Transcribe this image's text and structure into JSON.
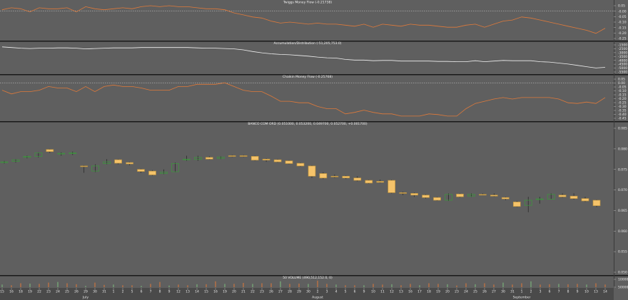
{
  "colors": {
    "background": "#5f5f5f",
    "separator": "#1a1a1a",
    "axis_strip": "#4a4a4a",
    "dotted_ref": "#d8d8d8",
    "orange": "#e07a3a",
    "white_line": "#f0f0f0",
    "candle_up": "#3a9a3a",
    "candle_down": "#f5c36a",
    "wick": "#222222"
  },
  "panels": [
    {
      "id": "twiggs",
      "title": "Twiggs Money Flow (-0.21738)",
      "yticks": [
        "0.05",
        "-0.00",
        "-0.05",
        "-0.10",
        "-0.15",
        "-0.20",
        "-0.25"
      ],
      "ylim": [
        -0.27,
        0.05
      ]
    },
    {
      "id": "ad",
      "title": "Accumulation/Distribution (-51,205,753.0)",
      "yticks": [
        "-1500",
        "-2500",
        "-3000",
        "-3500",
        "-4000",
        "-4500",
        "-5000",
        "-5500"
      ],
      "ylim": [
        -5600,
        -1500
      ]
    },
    {
      "id": "chaikin",
      "title": "Chaikin Money Flow (-0.25768)",
      "yticks": [
        "0.05",
        "0.00",
        "-0.05",
        "-0.10",
        "-0.15",
        "-0.20",
        "-0.25",
        "-0.30",
        "-0.35",
        "-0.40",
        "-0.45"
      ],
      "ylim": [
        -0.48,
        0.05
      ]
    },
    {
      "id": "price",
      "title": "BANCO COM ORD (0.051000, 0.053200, 0.049700, 0.052700, +0.001700)",
      "yticks": [
        "0.085",
        "0.080",
        "0.075",
        "0.070",
        "0.065",
        "0.060",
        "0.055",
        "0.050"
      ],
      "ylim": [
        0.047,
        0.089
      ]
    },
    {
      "id": "volume",
      "title": "50 VOLUME (490,512,152.0, 0)",
      "yticks": [
        "100000",
        "50000"
      ],
      "ylim": [
        0,
        120000
      ]
    }
  ],
  "xaxis": {
    "day_labels": [
      "15",
      "16",
      "18",
      "19",
      "22",
      "23",
      "24",
      "25",
      "26",
      "29",
      "30",
      "31",
      "1",
      "2",
      "5",
      "6",
      "7",
      "8",
      "9",
      "12",
      "13",
      "14",
      "15",
      "16",
      "19",
      "20",
      "21",
      "22",
      "23",
      "26",
      "27",
      "28",
      "29",
      "30",
      "2",
      "3",
      "4",
      "5",
      "6",
      "9",
      "10",
      "11",
      "12",
      "13",
      "16",
      "17",
      "18",
      "19",
      "20",
      "23",
      "24",
      "25",
      "26",
      "27",
      "30",
      "31",
      "1",
      "2",
      "3",
      "6",
      "7",
      "8",
      "9",
      "10",
      "13",
      "14"
    ],
    "months": [
      {
        "label": "July",
        "day_index": 9
      },
      {
        "label": "August",
        "day_index": 34
      },
      {
        "label": "September",
        "day_index": 56
      }
    ]
  },
  "chart_data": [
    {
      "type": "line",
      "name": "Twiggs Money Flow",
      "title": "Twiggs Money Flow (-0.21738)",
      "ylim": [
        -0.27,
        0.05
      ],
      "reference_line": 0,
      "series": [
        {
          "name": "",
          "color": "#e07a3a",
          "values": [
            0.01,
            0.03,
            0.02,
            -0.01,
            0.03,
            0.02,
            0.02,
            0.03,
            -0.01,
            0.04,
            0.02,
            0.01,
            0.02,
            0.03,
            0.02,
            0.04,
            0.05,
            0.04,
            0.05,
            0.04,
            0.04,
            0.03,
            0.02,
            0.02,
            0.01,
            -0.02,
            -0.04,
            -0.06,
            -0.07,
            -0.1,
            -0.12,
            -0.11,
            -0.12,
            -0.13,
            -0.12,
            -0.13,
            -0.13,
            -0.14,
            -0.15,
            -0.13,
            -0.16,
            -0.13,
            -0.14,
            -0.15,
            -0.13,
            -0.14,
            -0.14,
            -0.15,
            -0.16,
            -0.16,
            -0.14,
            -0.13,
            -0.16,
            -0.13,
            -0.1,
            -0.09,
            -0.06,
            -0.07,
            -0.09,
            -0.11,
            -0.13,
            -0.15,
            -0.17,
            -0.19,
            -0.22,
            -0.17
          ]
        }
      ]
    },
    {
      "type": "line",
      "name": "Accumulation/Distribution",
      "title": "Accumulation/Distribution (-51,205,753.0)",
      "ylim": [
        -5600,
        -1500
      ],
      "series": [
        {
          "name": "",
          "color": "#f0f0f0",
          "values": [
            -1800,
            -1900,
            -2000,
            -2050,
            -2000,
            -2000,
            -1950,
            -1950,
            -2000,
            -2100,
            -2050,
            -2000,
            -1950,
            -1950,
            -1950,
            -1900,
            -1900,
            -1900,
            -1900,
            -1900,
            -1900,
            -1950,
            -2000,
            -2000,
            -2050,
            -2100,
            -2250,
            -2500,
            -2700,
            -2850,
            -2950,
            -3000,
            -3100,
            -3200,
            -3350,
            -3450,
            -3500,
            -3700,
            -3800,
            -3800,
            -3900,
            -3850,
            -3850,
            -3950,
            -3950,
            -3950,
            -3950,
            -4000,
            -4000,
            -4050,
            -4050,
            -3900,
            -4050,
            -3950,
            -3850,
            -3900,
            -3900,
            -3900,
            -4050,
            -4100,
            -4250,
            -4400,
            -4600,
            -4800,
            -5000,
            -4900
          ]
        }
      ]
    },
    {
      "type": "line",
      "name": "Chaikin Money Flow",
      "title": "Chaikin Money Flow (-0.25768)",
      "ylim": [
        -0.48,
        0.05
      ],
      "reference_line": 0,
      "series": [
        {
          "name": "",
          "color": "#e07a3a",
          "values": [
            -0.1,
            -0.15,
            -0.12,
            -0.12,
            -0.1,
            -0.05,
            -0.07,
            -0.07,
            -0.12,
            -0.05,
            -0.12,
            -0.05,
            -0.03,
            -0.05,
            -0.05,
            -0.07,
            -0.1,
            -0.1,
            -0.1,
            -0.05,
            -0.05,
            -0.02,
            -0.02,
            -0.02,
            0.0,
            -0.05,
            -0.1,
            -0.12,
            -0.12,
            -0.18,
            -0.25,
            -0.25,
            -0.27,
            -0.27,
            -0.32,
            -0.35,
            -0.35,
            -0.42,
            -0.4,
            -0.37,
            -0.4,
            -0.42,
            -0.42,
            -0.45,
            -0.45,
            -0.45,
            -0.42,
            -0.43,
            -0.45,
            -0.45,
            -0.35,
            -0.28,
            -0.25,
            -0.22,
            -0.2,
            -0.22,
            -0.2,
            -0.2,
            -0.2,
            -0.2,
            -0.22,
            -0.27,
            -0.28,
            -0.26,
            -0.28,
            -0.2
          ]
        }
      ]
    },
    {
      "type": "candlestick",
      "name": "BANCO COM ORD",
      "title": "BANCO COM ORD (0.051000, 0.053200, 0.049700, 0.052700, +0.001700)",
      "ylim": [
        0.047,
        0.089
      ],
      "candles": [
        [
          0.079,
          0.0795,
          0.0787,
          0.0792
        ],
        [
          0.0793,
          0.08,
          0.079,
          0.0798
        ],
        [
          0.0805,
          0.081,
          0.0802,
          0.0808
        ],
        [
          0.0808,
          0.082,
          0.0805,
          0.0818
        ],
        [
          0.0828,
          0.083,
          0.0818,
          0.0822
        ],
        [
          0.0815,
          0.082,
          0.081,
          0.0817
        ],
        [
          0.0816,
          0.0822,
          0.0812,
          0.0818
        ],
        [
          0.078,
          0.0782,
          0.076,
          0.0778
        ],
        [
          0.0765,
          0.0785,
          0.0762,
          0.078
        ],
        [
          0.0787,
          0.08,
          0.0785,
          0.0792
        ],
        [
          0.0798,
          0.08,
          0.0785,
          0.0788
        ],
        [
          0.079,
          0.0792,
          0.0782,
          0.0786
        ],
        [
          0.077,
          0.0772,
          0.076,
          0.0764
        ],
        [
          0.0765,
          0.0768,
          0.0752,
          0.0754
        ],
        [
          0.0758,
          0.077,
          0.0756,
          0.0762
        ],
        [
          0.0763,
          0.079,
          0.0762,
          0.0787
        ],
        [
          0.0798,
          0.081,
          0.0795,
          0.08
        ],
        [
          0.0799,
          0.081,
          0.0795,
          0.0805
        ],
        [
          0.0805,
          0.0808,
          0.0798,
          0.08
        ],
        [
          0.0802,
          0.0808,
          0.08,
          0.0806
        ],
        [
          0.081,
          0.0812,
          0.0806,
          0.0808
        ],
        [
          0.081,
          0.0812,
          0.0806,
          0.0808
        ],
        [
          0.0808,
          0.081,
          0.0795,
          0.0797
        ],
        [
          0.08,
          0.0802,
          0.0792,
          0.0797
        ],
        [
          0.0798,
          0.08,
          0.079,
          0.0792
        ],
        [
          0.0795,
          0.0797,
          0.0785,
          0.0787
        ],
        [
          0.0788,
          0.079,
          0.0778,
          0.078
        ],
        [
          0.078,
          0.0782,
          0.0745,
          0.075
        ],
        [
          0.0758,
          0.0762,
          0.0742,
          0.0745
        ],
        [
          0.075,
          0.0755,
          0.0745,
          0.0748
        ],
        [
          0.075,
          0.0752,
          0.0742,
          0.0745
        ],
        [
          0.0745,
          0.075,
          0.0735,
          0.0738
        ],
        [
          0.0738,
          0.074,
          0.0728,
          0.073
        ],
        [
          0.0735,
          0.074,
          0.073,
          0.0732
        ],
        [
          0.0738,
          0.074,
          0.07,
          0.0702
        ],
        [
          0.0702,
          0.0705,
          0.0695,
          0.07
        ],
        [
          0.07,
          0.0702,
          0.069,
          0.0695
        ],
        [
          0.0695,
          0.0697,
          0.0685,
          0.0688
        ],
        [
          0.0688,
          0.069,
          0.0678,
          0.068
        ],
        [
          0.068,
          0.07,
          0.0678,
          0.0697
        ],
        [
          0.0698,
          0.07,
          0.0688,
          0.069
        ],
        [
          0.0692,
          0.07,
          0.069,
          0.0697
        ],
        [
          0.0697,
          0.07,
          0.0694,
          0.0696
        ],
        [
          0.0695,
          0.07,
          0.069,
          0.0692
        ],
        [
          0.0688,
          0.069,
          0.068,
          0.0684
        ],
        [
          0.0675,
          0.0678,
          0.066,
          0.0662
        ],
        [
          0.0665,
          0.069,
          0.0645,
          0.068
        ],
        [
          0.0682,
          0.069,
          0.067,
          0.0684
        ],
        [
          0.0683,
          0.07,
          0.0682,
          0.0697
        ],
        [
          0.0695,
          0.07,
          0.0688,
          0.069
        ],
        [
          0.0692,
          0.07,
          0.0682,
          0.0685
        ],
        [
          0.0685,
          0.069,
          0.0675,
          0.0678
        ],
        [
          0.068,
          0.0682,
          0.066,
          0.0664
        ]
      ]
    },
    {
      "type": "bar",
      "name": "Volume",
      "title": "50 VOLUME (490,512,152.0, 0)",
      "ylim": [
        0,
        120000
      ],
      "values": [
        40000,
        30000,
        60000,
        55000,
        50000,
        70000,
        80000,
        60000,
        45000,
        20000,
        70000,
        35000,
        40000,
        30000,
        30000,
        20000,
        50000,
        80000,
        25000,
        40000,
        30000,
        45000,
        45000,
        90000,
        50000,
        50000,
        65000,
        50000,
        60000,
        60000,
        90000,
        50000,
        55000,
        50000,
        100000,
        50000,
        40000,
        30000,
        30000,
        30000,
        50000,
        40000,
        45000,
        30000,
        50000,
        30000,
        60000,
        50000,
        45000,
        25000,
        60000,
        45000,
        60000,
        40000,
        70000,
        40000,
        60000,
        90000,
        40000,
        45000,
        50000,
        45000,
        50000,
        40000,
        60000,
        40000
      ]
    }
  ]
}
